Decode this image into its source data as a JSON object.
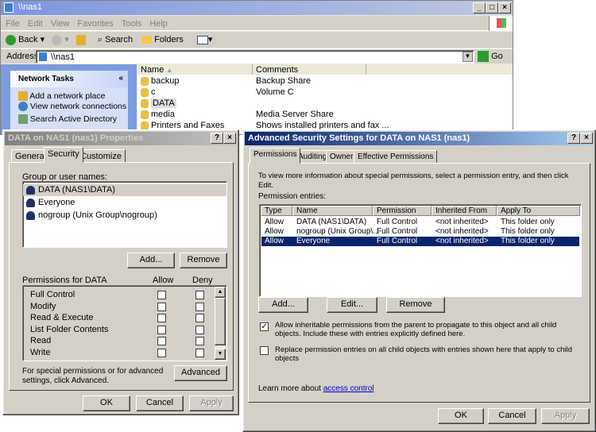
{
  "explorer": {
    "title": "\\\\nas1",
    "menu": [
      "File",
      "Edit",
      "View",
      "Favorites",
      "Tools",
      "Help"
    ],
    "toolbar": {
      "back": "Back",
      "search": "Search",
      "folders": "Folders"
    },
    "address_label": "Address",
    "address_value": "\\\\nas1",
    "go": "Go",
    "tasks": {
      "title": "Network Tasks",
      "items": [
        "Add a network place",
        "View network connections",
        "Search Active Directory"
      ]
    },
    "columns": [
      "Name",
      "Comments"
    ],
    "files": [
      {
        "name": "backup",
        "comment": "Backup Share"
      },
      {
        "name": "c",
        "comment": "Volume C"
      },
      {
        "name": "DATA",
        "comment": ""
      },
      {
        "name": "media",
        "comment": "Media Server Share"
      },
      {
        "name": "Printers and Faxes",
        "comment": "Shows installed printers and fax ..."
      }
    ]
  },
  "props": {
    "title": "DATA on NAS1 (nas1) Properties",
    "tabs": [
      "General",
      "Security",
      "Customize"
    ],
    "group_label": "Group or user names:",
    "users": [
      "DATA (NAS1\\DATA)",
      "Everyone",
      "nogroup (Unix Group\\nogroup)"
    ],
    "add": "Add...",
    "remove": "Remove",
    "perm_label": "Permissions for DATA",
    "allow": "Allow",
    "deny": "Deny",
    "perms": [
      {
        "name": "Full Control",
        "allow": false,
        "deny": false
      },
      {
        "name": "Modify",
        "allow": false,
        "deny": false
      },
      {
        "name": "Read & Execute",
        "allow": false,
        "deny": false
      },
      {
        "name": "List Folder Contents",
        "allow": false,
        "deny": false
      },
      {
        "name": "Read",
        "allow": false,
        "deny": false
      },
      {
        "name": "Write",
        "allow": false,
        "deny": false
      }
    ],
    "special_text": "For special permissions or for advanced settings, click Advanced.",
    "advanced": "Advanced",
    "ok": "OK",
    "cancel": "Cancel",
    "apply": "Apply"
  },
  "adv": {
    "title": "Advanced Security Settings for DATA on NAS1 (nas1)",
    "tabs": [
      "Permissions",
      "Auditing",
      "Owner",
      "Effective Permissions"
    ],
    "info": "To view more information about special permissions, select a permission entry, and then click Edit.",
    "entries_label": "Permission entries:",
    "columns": [
      "Type",
      "Name",
      "Permission",
      "Inherited From",
      "Apply To"
    ],
    "entries": [
      [
        "Allow",
        "DATA (NAS1\\DATA)",
        "Full Control",
        "<not inherited>",
        "This folder only"
      ],
      [
        "Allow",
        "nogroup (Unix Group\\...",
        "Full Control",
        "<not inherited>",
        "This folder only"
      ],
      [
        "Allow",
        "Everyone",
        "Full Control",
        "<not inherited>",
        "This folder only"
      ]
    ],
    "add": "Add...",
    "edit": "Edit...",
    "remove": "Remove",
    "inherit_text": "Allow inheritable permissions from the parent to propagate to this object and all child objects. Include these with entries explicitly defined here.",
    "replace_text": "Replace permission entries on all child objects with entries shown here that apply to child objects",
    "learn_prefix": "Learn more about ",
    "learn_link": "access control",
    "ok": "OK",
    "cancel": "Cancel",
    "apply": "Apply"
  }
}
